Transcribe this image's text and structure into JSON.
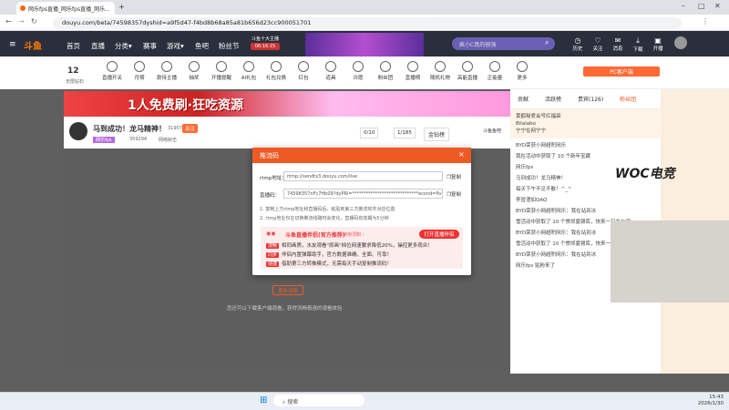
{
  "browser": {
    "tab_title": "网乐fps直播_网乐fps直播_网乐...",
    "url": "douyu.com/beta/74598357dyshid=a9f5d47-f4bd8b68a85a81b656d23cc900051701",
    "new_tab": "+",
    "win_min": "–",
    "win_max": "□",
    "win_close": "✕"
  },
  "header": {
    "logo": "斗鱼",
    "nav": [
      "首页",
      "直播",
      "分类▾",
      "赛事",
      "游戏▾",
      "鱼吧",
      "粉丝节"
    ],
    "event_badge": "斗鱼十大主播",
    "event_badge2": "06:16:15",
    "search_placeholder": "疯小C真的很强",
    "icons": [
      "历史",
      "关注",
      "消息",
      "下载",
      "开播"
    ]
  },
  "catbar": {
    "level": "12",
    "level_label": "无限钻石",
    "items": [
      "直播开关",
      "月榜",
      "款待主播",
      "抽奖",
      "开播提醒",
      "AI礼包",
      "礼包兑换",
      "红包",
      "道具",
      "许愿",
      "粉丝团",
      "直播榜",
      "随机礼物",
      "高能直播",
      "正能量",
      "更多"
    ],
    "pc_btn": "PC客户端"
  },
  "banner": {
    "text": "1人免费刷·狂吃资源"
  },
  "room": {
    "title": "马到成功！龙马精神！",
    "follow": "关注",
    "fans": "31907",
    "tag": "网乐fps",
    "count": "359294",
    "category": "网络射击",
    "rank1": "0/10",
    "rank2": "1/185",
    "rank2_label": "2周好友",
    "box": "金钻榜",
    "corner": "斗鱼鱼吧"
  },
  "modal": {
    "title": "推流码",
    "rtmp_label": "rtmp地址：",
    "rtmp_value": "rtmp://sendtx3.douyu.com/live",
    "copy": "复制",
    "key_label": "直播码：",
    "key_value": "74598357nFc7Hb09?dyPRl=*****************************econd=flv&roirecog",
    "note1": "1. 复制上方rtmp地址和直播码后，粘贴到第三方推流软件对应位置",
    "note2": "2. rtmp地址仅在切换推流线路时会变化，直播码有效期为5分钟",
    "promo_title": "斗鱼直播伴侣(官方推荐)",
    "promo_note": "使用须知 ›",
    "promo_btn": "打开直播伴侣",
    "promo_lines": [
      {
        "tag": "流畅",
        "text": "相同画质，水友观看\"原画\"档位网速要求降低20%，操控更多观众！"
      },
      {
        "tag": "同步",
        "text": "伴侣内置弹幕助手，官方数据准确、全面、可靠！"
      },
      {
        "tag": "便捷",
        "text": "借助第三方转推模式，无需每天手动复制推流码！"
      }
    ]
  },
  "player": {
    "error_btn": "重新加载",
    "error_text": "您还可以下载客户端观看，获得流畅极速的观看体验"
  },
  "sidebar": {
    "tabs": [
      "贡献",
      "活跃榜",
      "贵宾(126)",
      "粉丝团"
    ],
    "fans_notice": "网乐fps",
    "notice_text": "马到成功！龙马精神！",
    "users": [
      "黄鹤秘爱会号红福袋",
      "Bilalabo",
      "宁宁在网宁宁"
    ],
    "chats": [
      "BYD荣获小网超积网乐",
      "我在活动中获取了 10 个新年宝藏",
      "网乐fps",
      "马到成功！龙马精神！",
      "每天下午不见不散！^_^",
      "李冒澄如QAQ",
      "BYD荣获小网超积网乐：我在站到冰",
      "雪活动中获取了 10 个崇郊夏颢库，快来一起参与吧",
      "BYD荣获小网超积网乐：我在站到冰",
      "雪活动中获取了 10 个崇郊夏颢库，快来一起参与吧",
      "BYD荣获小网超积网乐：我在站到冰",
      "网乐fps 贴粉来了"
    ],
    "side_label": "WOC电竞"
  },
  "taskbar": {
    "search": "搜索",
    "time": "15:43",
    "date": "2026/1/30"
  },
  "colors": {
    "accent": "#ee5a24",
    "header_bg": "#2b2e3b"
  }
}
